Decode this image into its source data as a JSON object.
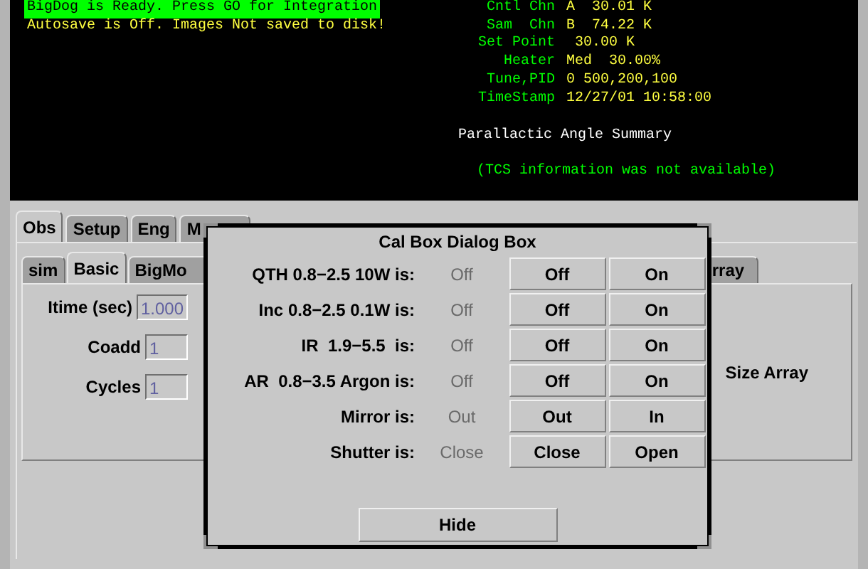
{
  "terminal": {
    "messages": [
      {
        "text": "BigDog is Ready. Press GO for Integration",
        "highlighted": true
      },
      {
        "text": "Autosave is Off. Images Not saved to disk!",
        "highlighted": false
      }
    ],
    "readings": [
      {
        "label": "Cntl Chn",
        "value": "A  30.01 K"
      },
      {
        "label": "Sam  Chn",
        "value": "B  74.22 K"
      },
      {
        "label": "Set Point",
        "value": " 30.00 K"
      },
      {
        "label": "Heater",
        "value": "Med  30.00%"
      },
      {
        "label": "Tune,PID",
        "value": "0 500,200,100"
      },
      {
        "label": "TimeStamp",
        "value": "12/27/01 10:58:00"
      }
    ],
    "summary_title": "Parallactic Angle Summary",
    "summary_note": "(TCS information was not available)"
  },
  "tabs": [
    {
      "label": "Obs",
      "selected": true
    },
    {
      "label": "Setup",
      "selected": false
    },
    {
      "label": "Eng",
      "selected": false
    },
    {
      "label": "M",
      "selected": false
    }
  ],
  "subtabs": [
    {
      "label": "sim",
      "selected": false
    },
    {
      "label": "Basic",
      "selected": true
    },
    {
      "label": "BigMo",
      "selected": false
    },
    {
      "label": "rray",
      "selected": false
    }
  ],
  "fields": [
    {
      "label": "Itime (sec)",
      "value": "1.000"
    },
    {
      "label": "Coadd",
      "value": "1"
    },
    {
      "label": "Cycles",
      "value": "1"
    }
  ],
  "panel_text": "Size Array",
  "dialog": {
    "title": "Cal Box Dialog Box",
    "rows": [
      {
        "label": "QTH 0.8−2.5 10W is:",
        "status": "Off",
        "buttons": [
          "Off",
          "On"
        ]
      },
      {
        "label": "Inc 0.8−2.5 0.1W is:",
        "status": "Off",
        "buttons": [
          "Off",
          "On"
        ]
      },
      {
        "label": "IR  1.9−5.5  is:",
        "status": "Off",
        "buttons": [
          "Off",
          "On"
        ]
      },
      {
        "label": "AR  0.8−3.5 Argon is:",
        "status": "Off",
        "buttons": [
          "Off",
          "On"
        ]
      },
      {
        "label": "Mirror is:",
        "status": "Out",
        "buttons": [
          "Out",
          "In"
        ]
      },
      {
        "label": "Shutter is:",
        "status": "Close",
        "buttons": [
          "Close",
          "Open"
        ]
      }
    ],
    "hide_button": "Hide"
  }
}
